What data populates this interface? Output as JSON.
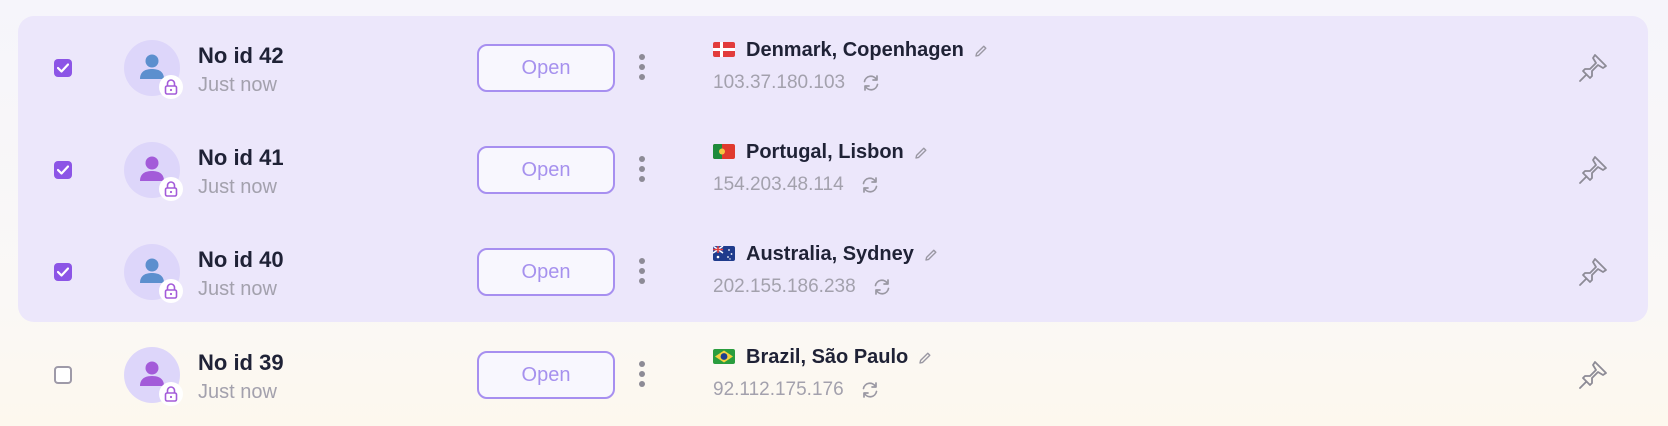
{
  "colors": {
    "accent": "#8c55e6",
    "selected_bg": "#ece7fb",
    "open_border": "#a78ff0",
    "text_dark": "#1f2236",
    "text_muted": "#a3a1ad"
  },
  "profiles": [
    {
      "name": "No id 42",
      "time": "Just now",
      "open_label": "Open",
      "location": "Denmark, Copenhagen",
      "ip": "103.37.180.103",
      "checked": true,
      "flag": "denmark-flag-icon",
      "avatar_color": "#5c8fce"
    },
    {
      "name": "No id 41",
      "time": "Just now",
      "open_label": "Open",
      "location": "Portugal, Lisbon",
      "ip": "154.203.48.114",
      "checked": true,
      "flag": "portugal-flag-icon",
      "avatar_color": "#a35bd9"
    },
    {
      "name": "No id 40",
      "time": "Just now",
      "open_label": "Open",
      "location": "Australia, Sydney",
      "ip": "202.155.186.238",
      "checked": true,
      "flag": "australia-flag-icon",
      "avatar_color": "#5c8fce"
    },
    {
      "name": "No id 39",
      "time": "Just now",
      "open_label": "Open",
      "location": "Brazil, São Paulo",
      "ip": "92.112.175.176",
      "checked": false,
      "flag": "brazil-flag-icon",
      "avatar_color": "#a35bd9"
    }
  ]
}
